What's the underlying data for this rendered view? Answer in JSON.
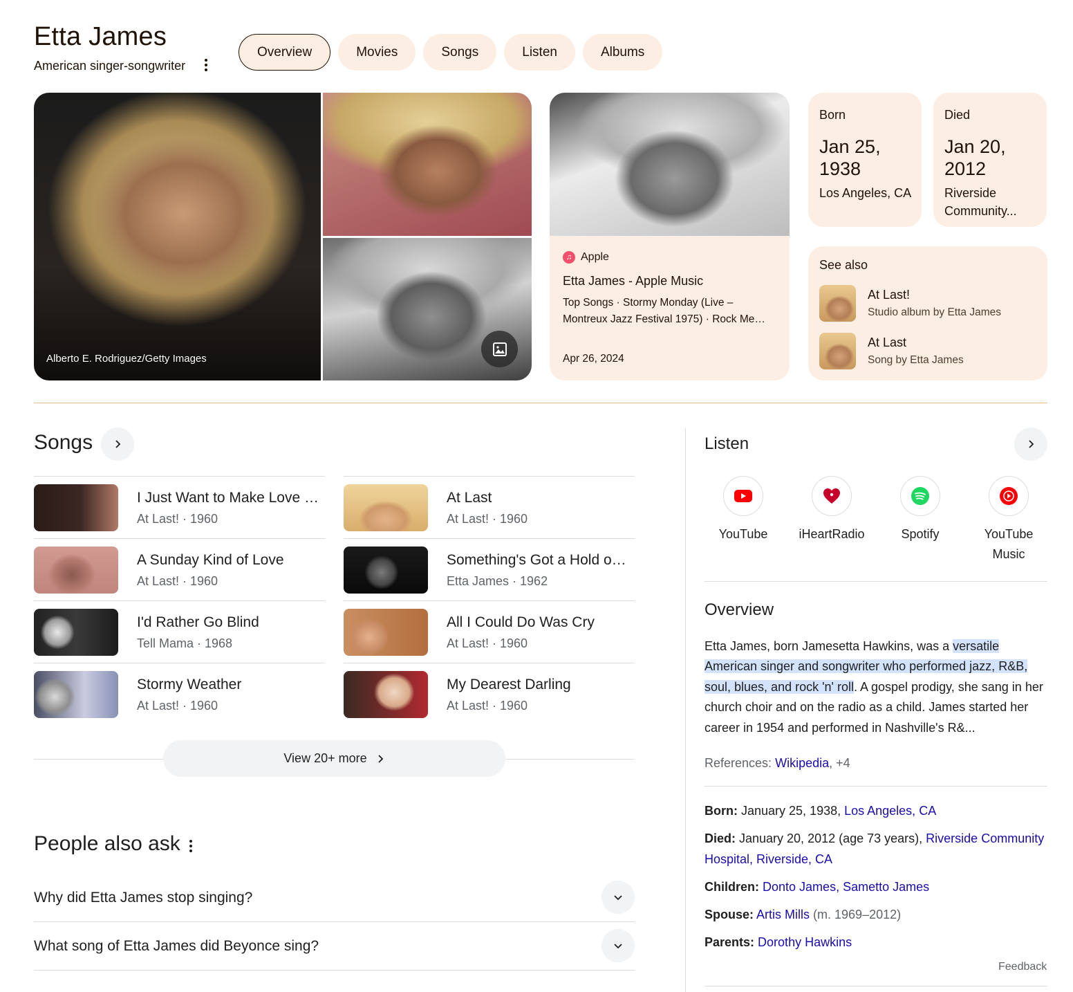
{
  "header": {
    "title": "Etta James",
    "subtitle": "American singer-songwriter",
    "tabs": [
      {
        "label": "Overview",
        "active": true
      },
      {
        "label": "Movies"
      },
      {
        "label": "Songs"
      },
      {
        "label": "Listen"
      },
      {
        "label": "Albums"
      }
    ]
  },
  "images": {
    "credit": "Alberto E. Rodriguez/Getty Images",
    "gallery_icon": "image-gallery-icon"
  },
  "apple_card": {
    "source": "Apple",
    "title": "Etta James - Apple Music",
    "description": "Top Songs · Stormy Monday (Live – Montreux Jazz Festival 1975) · Rock Me…",
    "date": "Apr 26, 2024"
  },
  "born": {
    "label": "Born",
    "date": "Jan 25, 1938",
    "place": "Los Angeles, CA"
  },
  "died": {
    "label": "Died",
    "date": "Jan 20, 2012",
    "place": "Riverside Community..."
  },
  "see_also": {
    "heading": "See also",
    "items": [
      {
        "title": "At Last!",
        "subtitle": "Studio album by Etta James"
      },
      {
        "title": "At Last",
        "subtitle": "Song by Etta James"
      }
    ]
  },
  "songs": {
    "heading": "Songs",
    "items": [
      {
        "title": "I Just Want to Make Love …",
        "meta": "At Last! · 1960"
      },
      {
        "title": "At Last",
        "meta": "At Last! · 1960"
      },
      {
        "title": "A Sunday Kind of Love",
        "meta": "At Last! · 1960"
      },
      {
        "title": "Something's Got a Hold o…",
        "meta": "Etta James · 1962"
      },
      {
        "title": "I'd Rather Go Blind",
        "meta": "Tell Mama · 1968"
      },
      {
        "title": "All I Could Do Was Cry",
        "meta": "At Last! · 1960"
      },
      {
        "title": "Stormy Weather",
        "meta": "At Last! · 1960"
      },
      {
        "title": "My Dearest Darling",
        "meta": "At Last! · 1960"
      }
    ],
    "view_more": "View 20+ more"
  },
  "paa": {
    "heading": "People also ask",
    "questions": [
      "Why did Etta James stop singing?",
      "What song of Etta James did Beyonce sing?"
    ]
  },
  "listen": {
    "heading": "Listen",
    "services": [
      {
        "name": "YouTube",
        "icon": "youtube-icon"
      },
      {
        "name": "iHeartRadio",
        "icon": "iheartradio-icon"
      },
      {
        "name": "Spotify",
        "icon": "spotify-icon"
      },
      {
        "name": "YouTube Music",
        "icon": "youtube-music-icon"
      }
    ]
  },
  "overview": {
    "heading": "Overview",
    "text_pre": "Etta James, born Jamesetta Hawkins, was a ",
    "text_highlight": "versatile American singer and songwriter who performed jazz, R&B, soul, blues, and rock 'n' roll",
    "text_post": ". A gospel prodigy, she sang in her church choir and on the radio as a child. James started her career in 1954 and performed in Nashville's R&...",
    "refs_label": "References:",
    "refs_link": "Wikipedia",
    "refs_more": ", +4"
  },
  "facts": {
    "born_label": "Born:",
    "born_text": " January 25, 1938, ",
    "born_link": "Los Angeles, CA",
    "died_label": "Died:",
    "died_text": " January 20, 2012 (age 73 years), ",
    "died_link": "Riverside Community Hospital, Riverside, CA",
    "children_label": "Children:",
    "children_link": "Donto James, Sametto James",
    "spouse_label": "Spouse:",
    "spouse_link": "Artis Mills",
    "spouse_text": " (m. 1969–2012)",
    "parents_label": "Parents:",
    "parents_link": "Dorothy Hawkins",
    "feedback": "Feedback"
  },
  "colors": {
    "card_bg": "#fdeee3",
    "link": "#1a0dab",
    "highlight": "#d3e3fd"
  }
}
